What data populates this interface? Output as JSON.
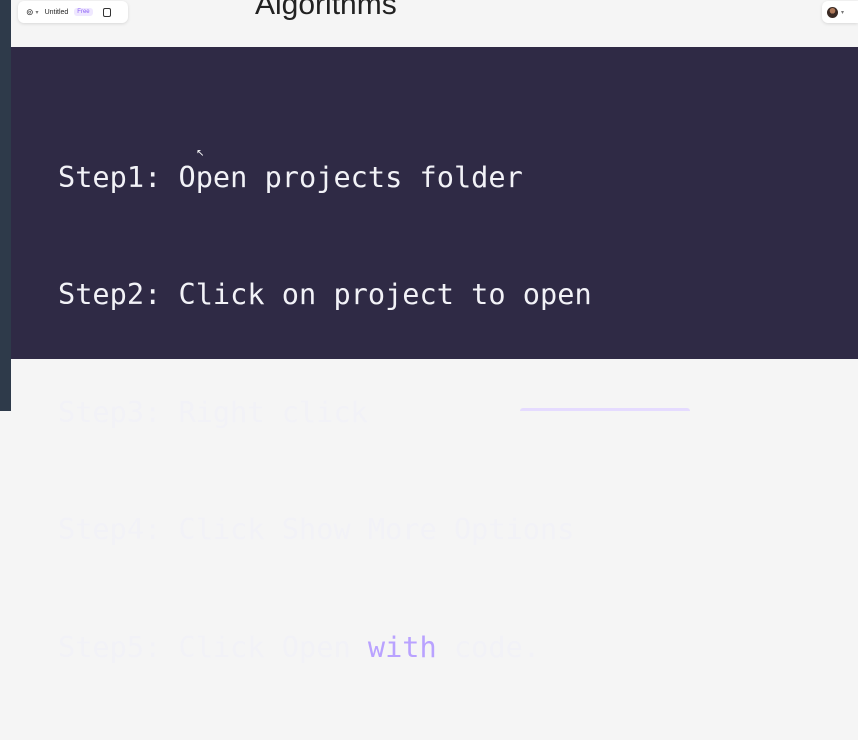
{
  "toolbar": {
    "menu_icon": "figma-menu-icon",
    "title": "Untitled",
    "badge": "Free",
    "panel_icon": "panel-toggle-icon"
  },
  "slide": {
    "heading": "Algorithms"
  },
  "user": {
    "avatar_icon": "user-avatar-icon"
  },
  "code": {
    "lines": [
      {
        "text": "Step1: Open projects folder"
      },
      {
        "text": "Step2: Click on project to open"
      },
      {
        "text": "Step3: Right click"
      },
      {
        "text": "Step4: Click Show More Options"
      },
      {
        "prefix": "Step5: Click Open ",
        "keyword": "with",
        "suffix": " code."
      }
    ]
  },
  "colors": {
    "code_background": "#2f2a45",
    "code_text": "#f2f2f7",
    "keyword": "#b9a2ff",
    "badge": "#8a5cf6"
  }
}
